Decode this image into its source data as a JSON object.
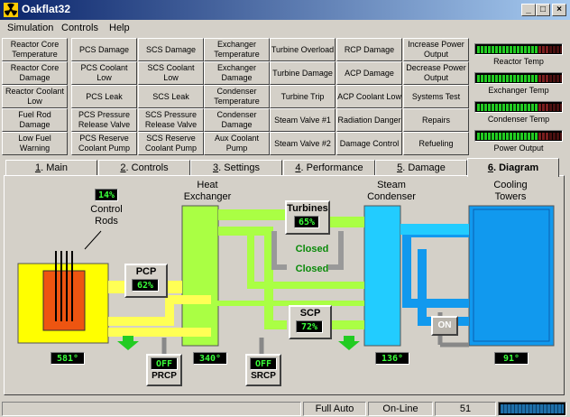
{
  "window": {
    "title": "Oakflat32"
  },
  "menu": [
    "Simulation",
    "Controls",
    "Help"
  ],
  "faults": [
    [
      "Reactor Core Temperature",
      "PCS Damage",
      "SCS Damage",
      "Exchanger Temperature",
      "Turbine Overload",
      "RCP Damage",
      "Increase Power Output"
    ],
    [
      "Reactor Core Damage",
      "PCS Coolant Low",
      "SCS Coolant Low",
      "Exchanger Damage",
      "Turbine Damage",
      "ACP Damage",
      "Decrease Power Output"
    ],
    [
      "Reactor Coolant Low",
      "PCS Leak",
      "SCS Leak",
      "Condenser Temperature",
      "Turbine Trip",
      "ACP Coolant Low",
      "Systems Test"
    ],
    [
      "Fuel Rod Damage",
      "PCS Pressure Release Valve",
      "SCS Pressure Release Valve",
      "Condenser Damage",
      "Steam Valve #1",
      "Radiation Danger",
      "Repairs"
    ],
    [
      "Low Fuel Warning",
      "PCS Reserve Coolant Pump",
      "SCS Reserve Coolant Pump",
      "Aux Coolant Pump",
      "Steam Valve #2",
      "Damage Control",
      "Refueling"
    ]
  ],
  "gauges": [
    {
      "label": "Reactor Temp",
      "level": 0.72
    },
    {
      "label": "Exchanger Temp",
      "level": 0.72
    },
    {
      "label": "Condenser Temp",
      "level": 0.72
    },
    {
      "label": "Power Output",
      "level": 0.72
    }
  ],
  "tabs": [
    {
      "num": "1",
      "label": ". Main"
    },
    {
      "num": "2",
      "label": ". Controls"
    },
    {
      "num": "3",
      "label": ". Settings"
    },
    {
      "num": "4",
      "label": ". Performance"
    },
    {
      "num": "5",
      "label": ". Damage"
    },
    {
      "num": "6",
      "label": ". Diagram",
      "active": true
    }
  ],
  "diagram": {
    "control_rods_pct": "14%",
    "control_rods_label": "Control Rods",
    "heat_exchanger_label": "Heat Exchanger",
    "steam_condenser_label": "Steam Condenser",
    "cooling_towers_label": "Cooling Towers",
    "turbines_label": "Turbines",
    "turbines_pct": "65%",
    "valve1_status": "Closed",
    "valve2_status": "Closed",
    "pcp_label": "PCP",
    "pcp_pct": "62%",
    "scp_label": "SCP",
    "scp_pct": "72%",
    "aux_pump_status": "ON",
    "prcp_status": "OFF",
    "prcp_label": "PRCP",
    "srcp_status": "OFF",
    "srcp_label": "SRCP",
    "reactor_temp": "581°",
    "exchanger_temp": "340°",
    "condenser_temp": "136°",
    "towers_temp": "91°",
    "colors": {
      "reactor": "#ffff00",
      "primary_loop": "#ffff66",
      "secondary_loop": "#aaff44",
      "condenser": "#22ccff",
      "towers": "#1199ee",
      "core": "#ee5511"
    }
  },
  "status": {
    "mode": "Full Auto",
    "online": "On-Line",
    "value": "51"
  }
}
